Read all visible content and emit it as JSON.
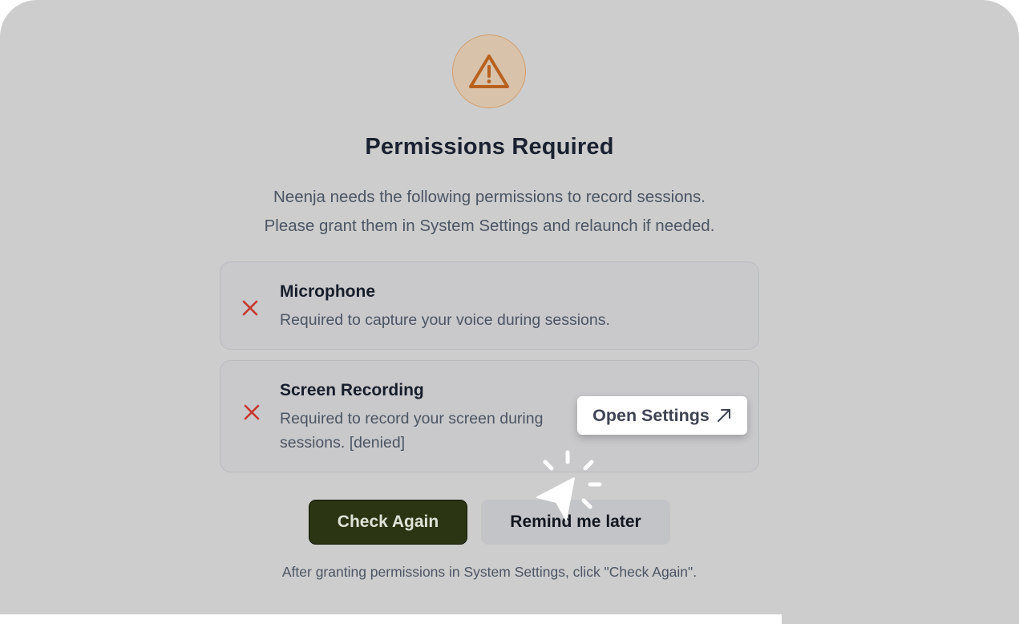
{
  "dialog": {
    "icon": "warning-triangle-icon",
    "title": "Permissions Required",
    "subtitle_line1": "Neenja needs the following permissions to record sessions.",
    "subtitle_line2": "Please grant them in System Settings and relaunch if needed."
  },
  "permissions": [
    {
      "status_icon": "cross-icon",
      "title": "Microphone",
      "description": "Required to capture your voice during sessions."
    },
    {
      "status_icon": "cross-icon",
      "title": "Screen Recording",
      "description_line1": "Required to record your screen during",
      "description_line2": "sessions. [denied]",
      "action_label": "Open Settings",
      "action_icon": "external-arrow-icon"
    }
  ],
  "actions": {
    "check_again_label": "Check Again",
    "remind_later_label": "Remind me later"
  },
  "hint": "After granting permissions in System Settings, click \"Check Again\".",
  "colors": {
    "background": "#cdcdcd",
    "primary_button": "#2b3514",
    "error": "#c8372d",
    "warning": "#b8611f"
  }
}
